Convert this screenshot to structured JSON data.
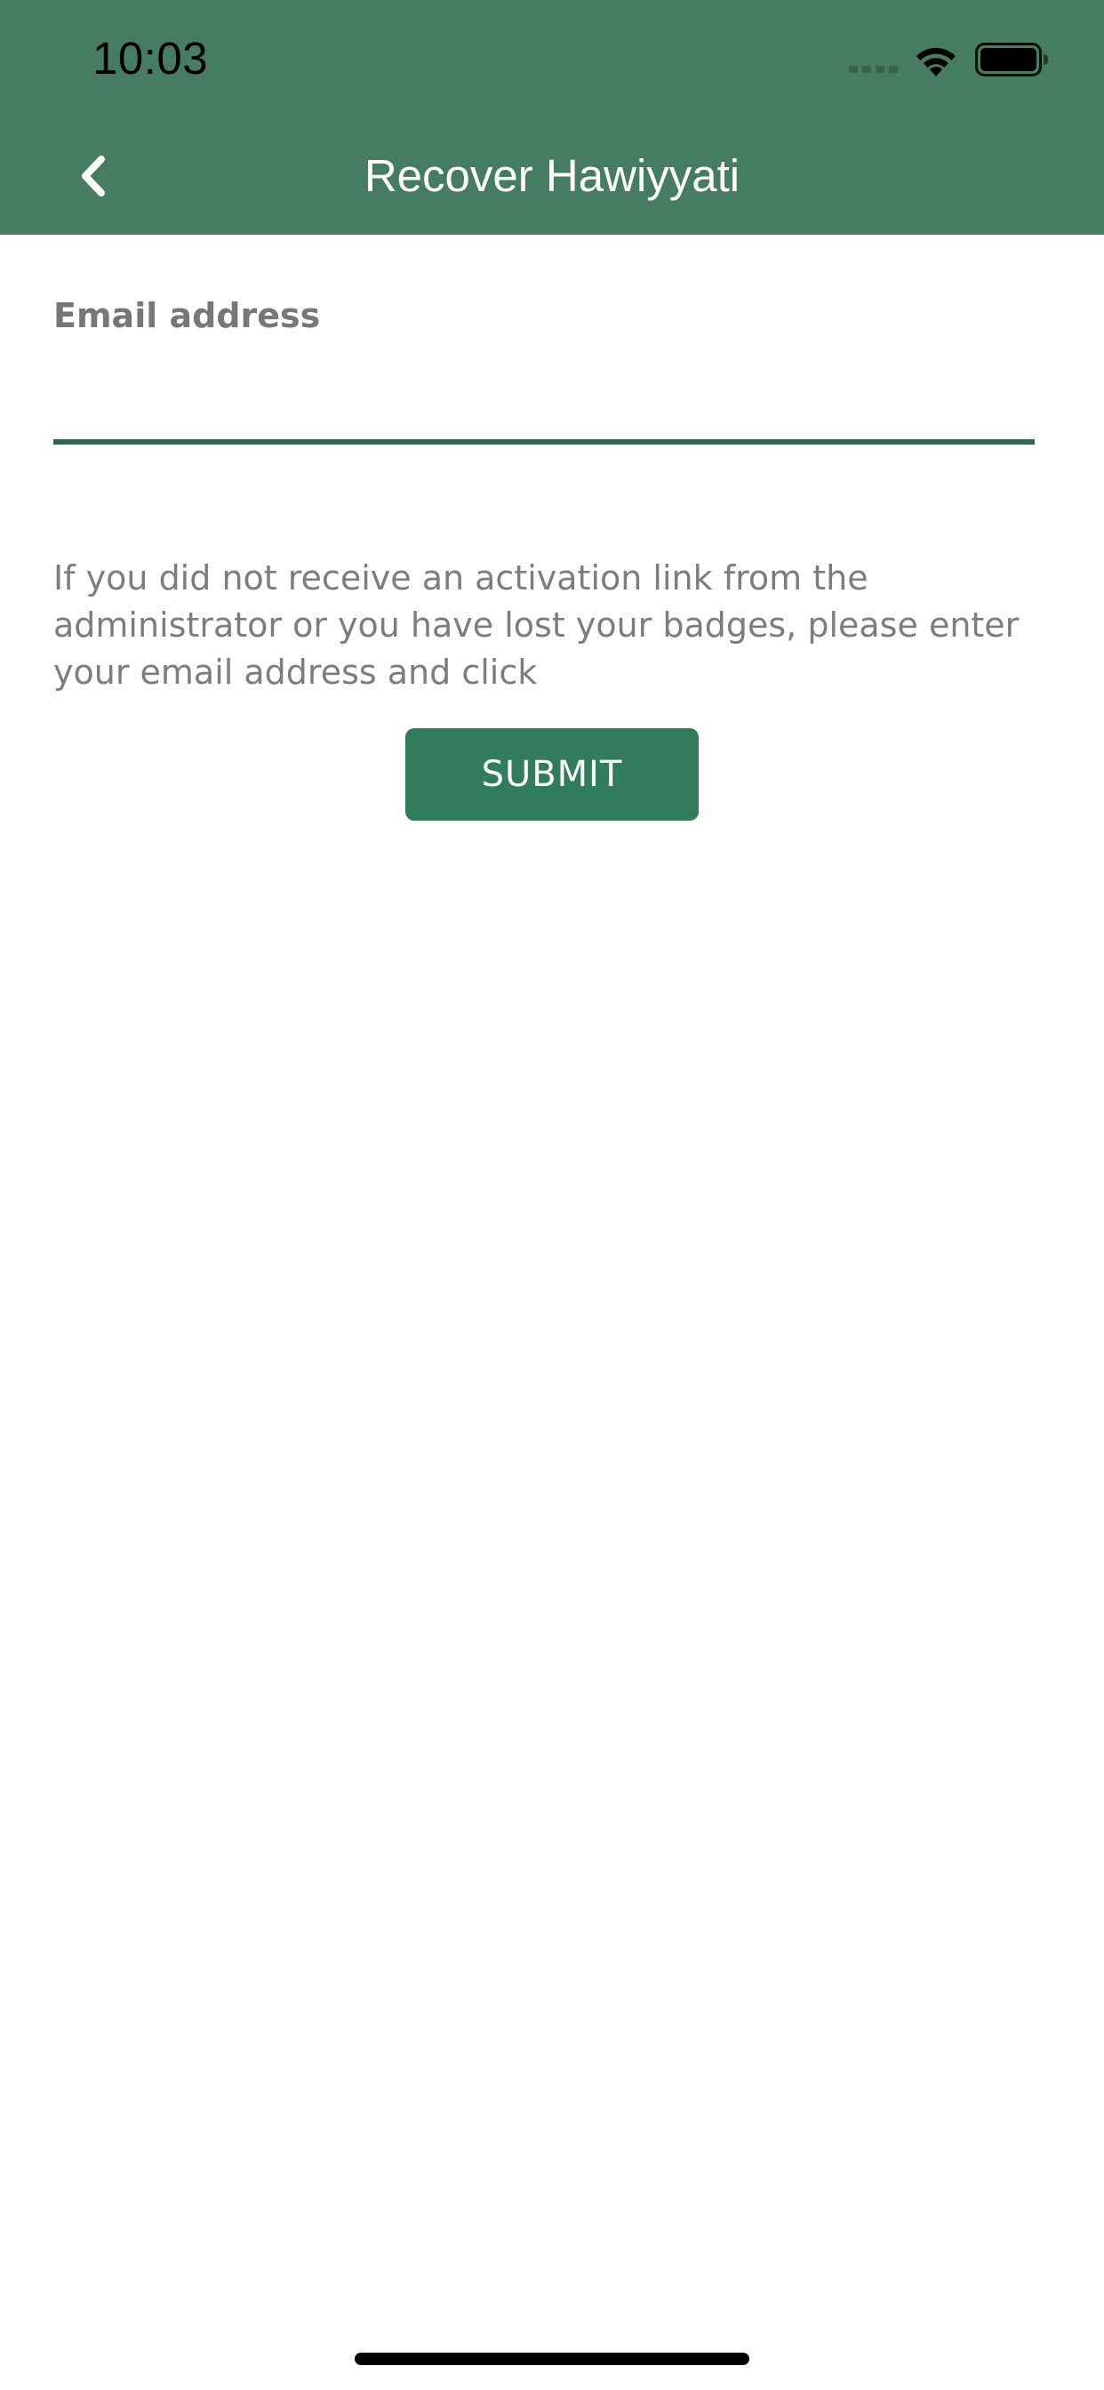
{
  "status_bar": {
    "time": "10:03",
    "icons": [
      "signal-icon",
      "wifi-icon",
      "battery-icon"
    ]
  },
  "nav": {
    "back_icon": "chevron-left-icon",
    "title": "Recover Hawiyyati"
  },
  "form": {
    "email_label": "Email address",
    "email_value": "",
    "help_text": "If you did not receive an activation link from the administrator or you have lost your badges, please enter your email address and click",
    "submit_label": "SUBMIT"
  },
  "colors": {
    "header_bg": "#467d62",
    "accent": "#327c5e",
    "input_underline": "#2f6a4e",
    "text_muted": "#7d7d7d"
  }
}
